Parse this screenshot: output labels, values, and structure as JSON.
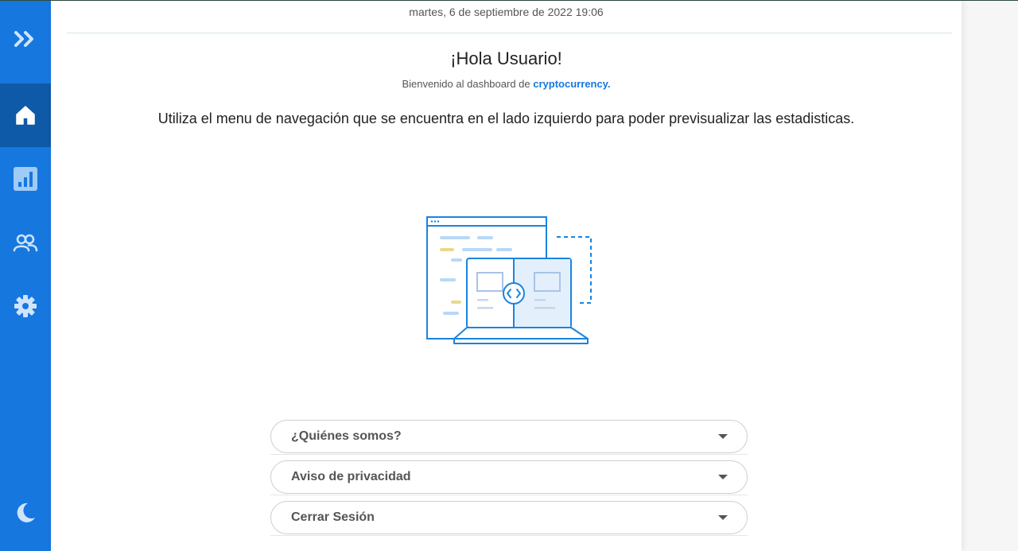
{
  "sidebar": {
    "items": [
      {
        "name": "expand",
        "icon": "double-chevron-right-icon"
      },
      {
        "name": "home",
        "icon": "home-icon",
        "active": true
      },
      {
        "name": "stats",
        "icon": "bar-chart-icon"
      },
      {
        "name": "users",
        "icon": "users-icon"
      },
      {
        "name": "settings",
        "icon": "gear-icon"
      },
      {
        "name": "dark-mode",
        "icon": "moon-icon"
      }
    ],
    "color": "#1677df",
    "active_color": "#0e5aa8"
  },
  "header": {
    "date": "martes, 6 de septiembre de 2022 19:06"
  },
  "main": {
    "greeting": "¡Hola Usuario!",
    "welcome_prefix": "Bienvenido al dashboard de",
    "welcome_brand": "cryptocurrency.",
    "instruction": "Utiliza el menu de navegación que se encuentra en el lado izquierdo para poder previsualizar las estadisticas.",
    "illustration_icon": "laptop-code-illustration"
  },
  "accordion": [
    {
      "label": "¿Quiénes somos?"
    },
    {
      "label": "Aviso de privacidad"
    },
    {
      "label": "Cerrar Sesión"
    }
  ]
}
